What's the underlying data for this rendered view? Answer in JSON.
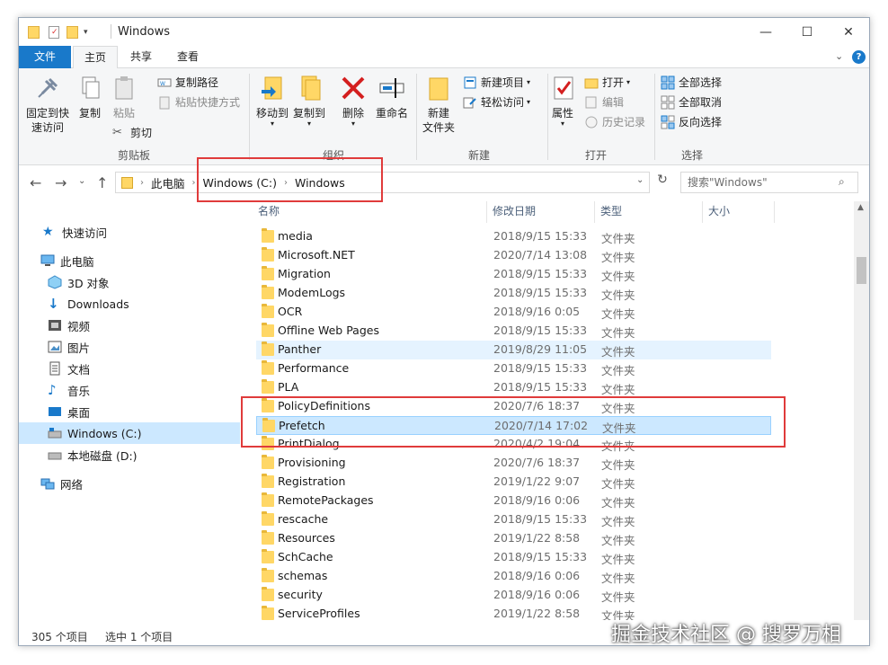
{
  "window": {
    "title": "Windows",
    "controls": {
      "minimize": "—",
      "maximize": "☐",
      "close": "✕"
    }
  },
  "tabs": {
    "file": "文件",
    "home": "主页",
    "share": "共享",
    "view": "查看"
  },
  "ribbon": {
    "clipboard": {
      "label": "剪贴板",
      "pin": "固定到快\n速访问",
      "copy": "复制",
      "paste": "粘贴",
      "copy_path": "复制路径",
      "paste_shortcut": "粘贴快捷方式",
      "cut": "剪切"
    },
    "organize": {
      "label": "组织",
      "move_to": "移动到",
      "copy_to": "复制到",
      "delete": "删除",
      "rename": "重命名"
    },
    "new": {
      "label": "新建",
      "new_folder": "新建\n文件夹",
      "new_item": "新建项目",
      "easy_access": "轻松访问"
    },
    "open": {
      "label": "打开",
      "properties": "属性",
      "open": "打开",
      "edit": "编辑",
      "history": "历史记录"
    },
    "select": {
      "label": "选择",
      "select_all": "全部选择",
      "select_none": "全部取消",
      "invert": "反向选择"
    }
  },
  "address": {
    "crumbs": [
      "此电脑",
      "Windows (C:)",
      "Windows"
    ],
    "search_placeholder": "搜索\"Windows\""
  },
  "nav": {
    "quick_access": "快速访问",
    "this_pc": "此电脑",
    "objects3d": "3D 对象",
    "downloads": "Downloads",
    "videos": "视频",
    "pictures": "图片",
    "documents": "文档",
    "music": "音乐",
    "desktop": "桌面",
    "drive_c": "Windows (C:)",
    "drive_d": "本地磁盘 (D:)",
    "network": "网络"
  },
  "columns": {
    "name": "名称",
    "date": "修改日期",
    "type": "类型",
    "size": "大小"
  },
  "files": [
    {
      "name": "media",
      "date": "2018/9/15 15:33",
      "type": "文件夹"
    },
    {
      "name": "Microsoft.NET",
      "date": "2020/7/14 13:08",
      "type": "文件夹"
    },
    {
      "name": "Migration",
      "date": "2018/9/15 15:33",
      "type": "文件夹"
    },
    {
      "name": "ModemLogs",
      "date": "2018/9/15 15:33",
      "type": "文件夹"
    },
    {
      "name": "OCR",
      "date": "2018/9/16 0:05",
      "type": "文件夹"
    },
    {
      "name": "Offline Web Pages",
      "date": "2018/9/15 15:33",
      "type": "文件夹"
    },
    {
      "name": "Panther",
      "date": "2019/8/29 11:05",
      "type": "文件夹"
    },
    {
      "name": "Performance",
      "date": "2018/9/15 15:33",
      "type": "文件夹"
    },
    {
      "name": "PLA",
      "date": "2018/9/15 15:33",
      "type": "文件夹"
    },
    {
      "name": "PolicyDefinitions",
      "date": "2020/7/6 18:37",
      "type": "文件夹"
    },
    {
      "name": "Prefetch",
      "date": "2020/7/14 17:02",
      "type": "文件夹"
    },
    {
      "name": "PrintDialog",
      "date": "2020/4/2 19:04",
      "type": "文件夹"
    },
    {
      "name": "Provisioning",
      "date": "2020/7/6 18:37",
      "type": "文件夹"
    },
    {
      "name": "Registration",
      "date": "2019/1/22 9:07",
      "type": "文件夹"
    },
    {
      "name": "RemotePackages",
      "date": "2018/9/16 0:06",
      "type": "文件夹"
    },
    {
      "name": "rescache",
      "date": "2018/9/15 15:33",
      "type": "文件夹"
    },
    {
      "name": "Resources",
      "date": "2019/1/22 8:58",
      "type": "文件夹"
    },
    {
      "name": "SchCache",
      "date": "2018/9/15 15:33",
      "type": "文件夹"
    },
    {
      "name": "schemas",
      "date": "2018/9/16 0:06",
      "type": "文件夹"
    },
    {
      "name": "security",
      "date": "2018/9/16 0:06",
      "type": "文件夹"
    },
    {
      "name": "ServiceProfiles",
      "date": "2019/1/22 8:58",
      "type": "文件夹"
    }
  ],
  "status": {
    "count": "305 个项目",
    "selected": "选中 1 个项目"
  },
  "watermark": "掘金技术社区 @ 搜罗万相",
  "colors": {
    "accent": "#1979ca",
    "selection": "#cce8ff",
    "highlight": "#e03b3b"
  }
}
